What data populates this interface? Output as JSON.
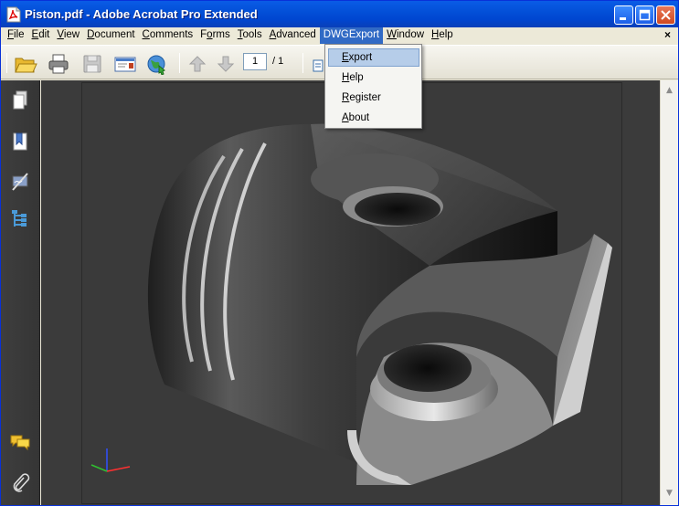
{
  "window": {
    "title": "Piston.pdf - Adobe Acrobat Pro Extended"
  },
  "menubar": {
    "items": [
      {
        "label": "File",
        "u": "F",
        "rest": "ile"
      },
      {
        "label": "Edit",
        "u": "E",
        "rest": "dit"
      },
      {
        "label": "View",
        "u": "V",
        "rest": "iew"
      },
      {
        "label": "Document",
        "u": "D",
        "rest": "ocument"
      },
      {
        "label": "Comments",
        "u": "C",
        "rest": "omments"
      },
      {
        "label": "Forms",
        "pre": "F",
        "u": "o",
        "rest": "rms"
      },
      {
        "label": "Tools",
        "u": "T",
        "rest": "ools"
      },
      {
        "label": "Advanced",
        "u": "A",
        "rest": "dvanced"
      },
      {
        "label": "DWGExport"
      },
      {
        "label": "Window",
        "u": "W",
        "rest": "indow"
      },
      {
        "label": "Help",
        "u": "H",
        "rest": "elp"
      }
    ],
    "mdi_close": "×"
  },
  "toolbar": {
    "page_number": "1",
    "page_total": "/ 1"
  },
  "dropdown": {
    "items": [
      {
        "u": "E",
        "rest": "xport",
        "highlighted": true
      },
      {
        "u": "H",
        "rest": "elp"
      },
      {
        "u": "R",
        "rest": "egister"
      },
      {
        "u": "A",
        "rest": "bout"
      }
    ]
  },
  "icons": {
    "toolbar": [
      "open-folder-icon",
      "print-icon",
      "save-icon",
      "email-icon",
      "web-globe-icon",
      "previous-page-icon",
      "next-page-icon"
    ],
    "leftpanel": [
      "pages-icon",
      "bookmarks-icon",
      "signatures-icon",
      "model-tree-icon",
      "comments-icon",
      "attachments-icon"
    ]
  },
  "colors": {
    "titlebar": "#0350d8",
    "menu_active": "#316ac5",
    "menu_highlight": "#b6cde9",
    "document_background": "#3b3b3b"
  }
}
